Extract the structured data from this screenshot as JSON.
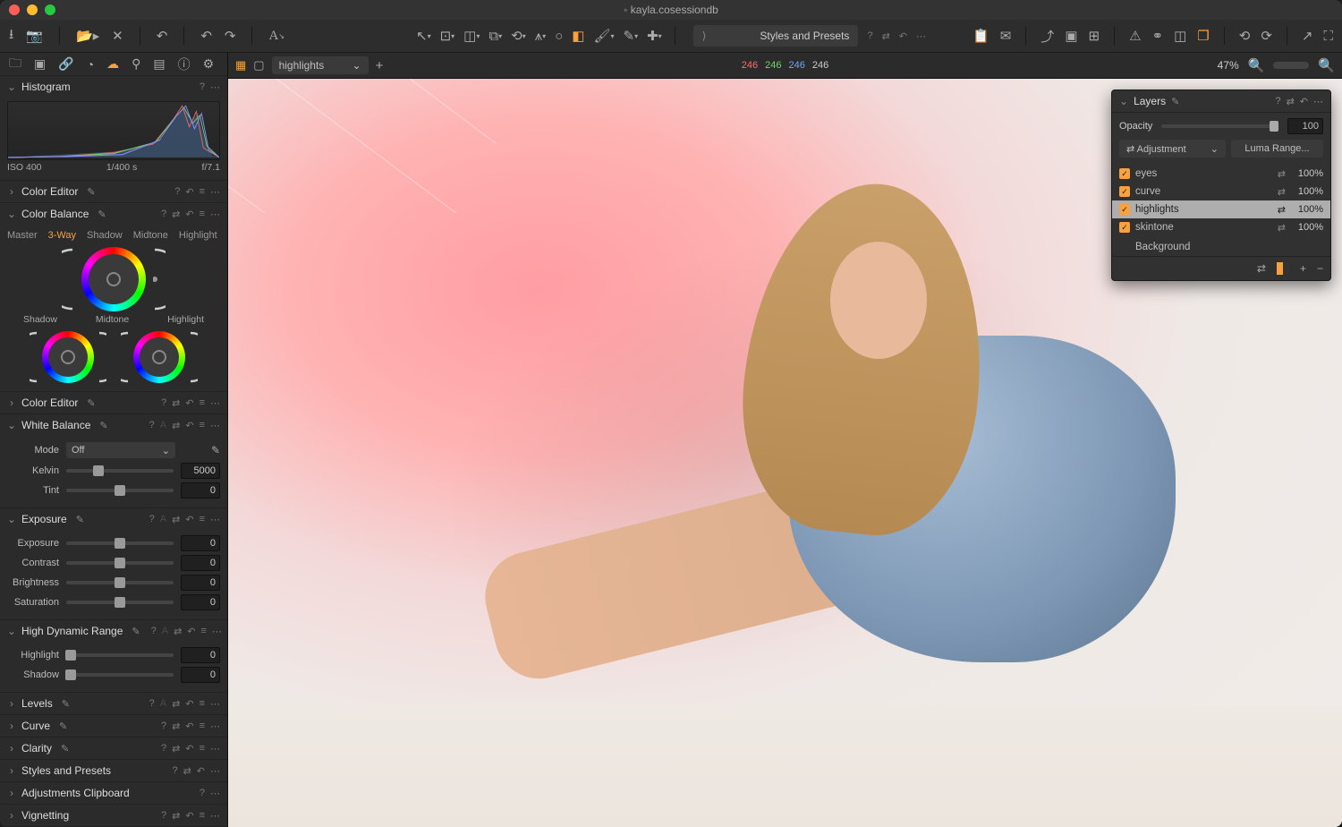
{
  "title": "kayla.cosessiondb",
  "toolbar": {
    "importIcon": "import-icon",
    "cameraIcon": "camera-icon",
    "folderIcon": "folder-icon",
    "closeIcon": "close-x-icon",
    "undoHistIcon": "undo-history-icon",
    "undoIcon": "undo-icon",
    "redoIcon": "redo-icon",
    "annotateIcon": "annotate-A-icon",
    "cursorIcon": "cursor-icon",
    "handIcon": "hand-icon",
    "selectIcon": "select-box-icon",
    "cropIcon": "crop-icon",
    "rotateIcon": "rotate-icon",
    "keystoneIcon": "keystone-icon",
    "shapeIcon": "ellipse-icon",
    "maskIcon": "gradient-mask-icon",
    "brushIcon": "brush-icon",
    "eraseIcon": "erase-icon",
    "repairIcon": "repair-icon",
    "stylesLabel": "Styles and Presets",
    "dd1": "question-icon",
    "dd2": "swap-icon",
    "dd3": "reset-arrow-icon",
    "dd4": "more-icon",
    "clipboardIcon": "clipboard-icon",
    "mailIcon": "mail-icon",
    "exportIcon": "export-icon",
    "cropViewIcon": "frame-icon",
    "gridIcon": "grid-icon",
    "warnIcon": "warning-icon",
    "focusIcon": "focus-mask-icon",
    "compareIcon": "compare-icon",
    "multiIcon": "multi-view-icon",
    "rotLIcon": "rotate-ccw-icon",
    "rotRIcon": "rotate-cw-icon",
    "moveIcon": "arrow-expand-icon",
    "fullIcon": "fullscreen-icon"
  },
  "toolTabs": {
    "lib": "library-icon",
    "camera": "camera-icon",
    "quick": "link-icon",
    "people": "people-icon",
    "color": "color-palette-icon",
    "lens": "lens-icon",
    "meta": "metadata-icon",
    "info": "info-icon",
    "gear": "gear-icon",
    "plus": "plus-icon",
    "settings": "sliders-icon"
  },
  "centerBar": {
    "gridIcon": "grid-view-icon",
    "singleIcon": "single-view-icon",
    "layerSel": "highlights",
    "plusIcon": "add-icon",
    "r": "246",
    "g": "246",
    "b": "246",
    "w": "246",
    "zoom": "47%",
    "loupeIcon": "loupe-icon",
    "sliderIcon": "zoom-slider",
    "searchIcon": "search-icon"
  },
  "histogram": {
    "title": "Histogram",
    "iso": "ISO 400",
    "shutter": "1/400 s",
    "fstop": "f/7.1"
  },
  "colorBalance": {
    "title": "Color Balance",
    "tabs": {
      "master": "Master",
      "threeway": "3-Way",
      "shadow": "Shadow",
      "midtone": "Midtone",
      "highlight": "Highlight"
    },
    "labels": {
      "shadow": "Shadow",
      "midtone": "Midtone",
      "highlight": "Highlight"
    }
  },
  "panelTitles": {
    "colorEditor1": "Color Editor",
    "colorEditor2": "Color Editor",
    "whiteBalance": "White Balance",
    "exposure": "Exposure",
    "hdr": "High Dynamic Range",
    "levels": "Levels",
    "curve": "Curve",
    "clarity": "Clarity",
    "styles": "Styles and Presets",
    "adjClip": "Adjustments Clipboard",
    "vignetting": "Vignetting"
  },
  "wb": {
    "modeLbl": "Mode",
    "modeVal": "Off",
    "kelvinLbl": "Kelvin",
    "kelvinVal": "5000",
    "tintLbl": "Tint",
    "tintVal": "0"
  },
  "exp": {
    "expLbl": "Exposure",
    "expVal": "0",
    "conLbl": "Contrast",
    "conVal": "0",
    "briLbl": "Brightness",
    "briVal": "0",
    "satLbl": "Saturation",
    "satVal": "0"
  },
  "hdr": {
    "hiLbl": "Highlight",
    "hiVal": "0",
    "shLbl": "Shadow",
    "shVal": "0"
  },
  "layers": {
    "title": "Layers",
    "opLbl": "Opacity",
    "opVal": "100",
    "typeDd": "Adjustment",
    "lumaBtn": "Luma Range...",
    "items": [
      {
        "name": "eyes",
        "pct": "100%",
        "sel": false
      },
      {
        "name": "curve",
        "pct": "100%",
        "sel": false
      },
      {
        "name": "highlights",
        "pct": "100%",
        "sel": true
      },
      {
        "name": "skintone",
        "pct": "100%",
        "sel": false
      }
    ],
    "background": "Background"
  }
}
